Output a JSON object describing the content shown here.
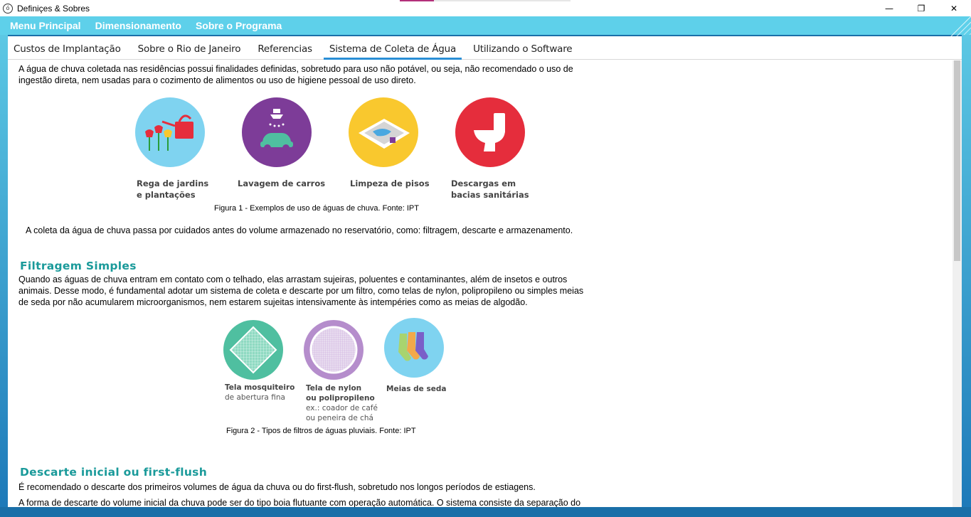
{
  "window": {
    "title": "Definiçes & Sobres",
    "icon": "app-icon",
    "minimize_glyph": "—",
    "maximize_glyph": "❐",
    "close_glyph": "✕"
  },
  "menu": {
    "items": [
      "Menu Principal",
      "Dimensionamento",
      "Sobre o Programa"
    ]
  },
  "tabs": [
    "Custos de Implantação",
    "Sobre o Rio de Janeiro",
    "Referencias",
    "Sistema de Coleta de Água",
    "Utilizando o Software"
  ],
  "active_tab": "Sistema de Coleta de Água",
  "content": {
    "intro_line1": "A água de chuva coletada nas residências possui finalidades definidas, sobretudo para uso não potável, ou seja, não recomendado o uso de",
    "intro_line2": "ingestão direta, nem usadas para o cozimento de alimentos ou uso de higiene pessoal de uso direto.",
    "uses": [
      {
        "line1": "Rega de jardins",
        "line2": "e plantações",
        "color": "#7fd3f0",
        "icon": "watering-can-icon"
      },
      {
        "line1": "Lavagem de carros",
        "line2": "",
        "color": "#7d3c98",
        "icon": "car-wash-icon"
      },
      {
        "line1": "Limpeza de pisos",
        "line2": "",
        "color": "#f9c82e",
        "icon": "floor-cleaning-icon"
      },
      {
        "line1": "Descargas em",
        "line2": "bacias sanitárias",
        "color": "#e52d3c",
        "icon": "toilet-icon"
      }
    ],
    "figure1_caption": "Figura 1 - Exemplos de uso de águas de chuva. Fonte:  IPT",
    "coleta_text": "A coleta da água de chuva passa por cuidados antes do volume armazenado no reservatório, como: filtragem, descarte e armazenamento.",
    "filtragem_title": "Filtragem Simples",
    "filtragem_line1": "Quando as águas de chuva entram em contato com o telhado, elas arrastam sujeiras, poluentes e contaminantes, além de insetos e outros",
    "filtragem_line2": "animais. Desse modo, é fundamental adotar um sistema de coleta e descarte por um filtro, como telas de nylon, polipropileno ou simples meias",
    "filtragem_line3": "de seda por não acumularem microorganismos, nem estarem sujeitas intensivamente às intempéries como as meias de algodão.",
    "filters": [
      {
        "title": "Tela mosquiteiro",
        "title2": "",
        "sub1": "de abertura fina",
        "sub2": "",
        "sub3": "",
        "color": "#4fbfa0",
        "icon": "mosquito-net-icon"
      },
      {
        "title": "Tela de nylon",
        "title2": "ou polipropileno",
        "sub1": "ex.: coador de café",
        "sub2": "ou peneira de chá",
        "sub3": "",
        "color": "#b58dcc",
        "icon": "nylon-mesh-icon"
      },
      {
        "title": "Meias de seda",
        "title2": "",
        "sub1": "",
        "sub2": "",
        "sub3": "",
        "color": "#7fd3f0",
        "icon": "socks-icon"
      }
    ],
    "figure2_caption": "Figura 2 - Tipos de filtros de águas pluviais. Fonte: IPT",
    "descarte_title": "Descarte inicial ou first-flush",
    "descarte_line1": "É recomendado o descarte dos primeiros volumes de água da chuva ou do first-flush, sobretudo nos longos períodos de estiagens.",
    "descarte_line2": "A forma de descarte do volume inicial da chuva pode ser do tipo boia flutuante com operação automática. O sistema consiste da separação do"
  }
}
